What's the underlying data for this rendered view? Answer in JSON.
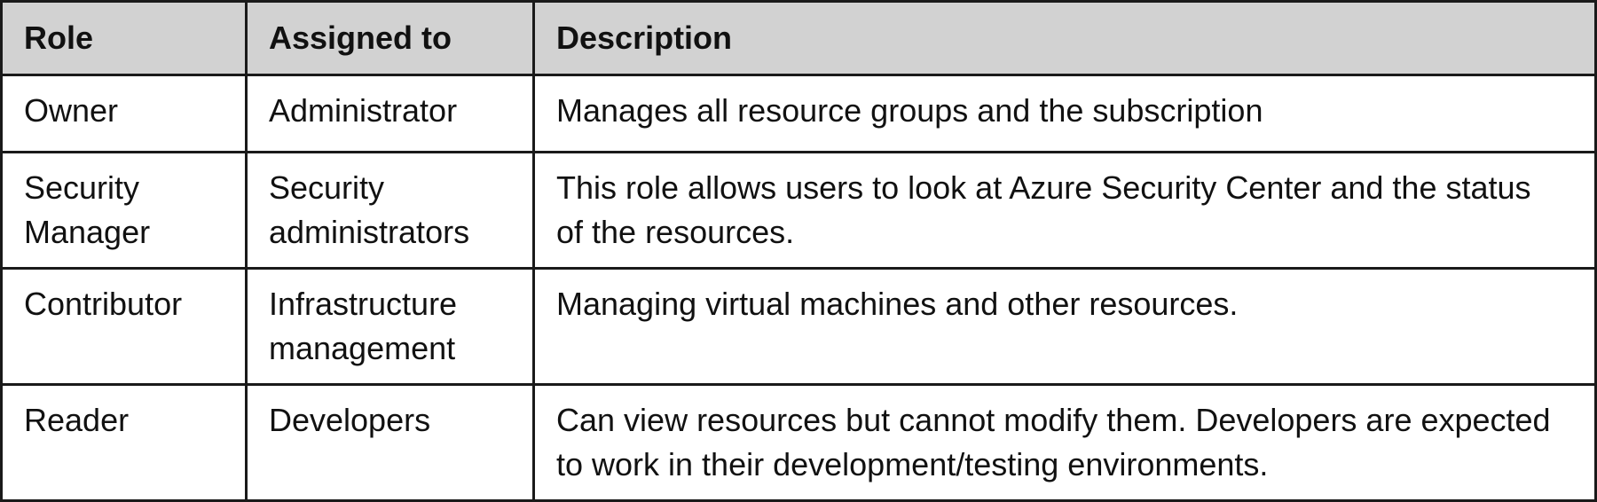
{
  "table": {
    "headers": [
      "Role",
      "Assigned to",
      "Description"
    ],
    "rows": [
      {
        "role": "Owner",
        "assigned_to": "Administrator",
        "description": "Manages all resource groups and the subscription"
      },
      {
        "role": "Security Manager",
        "assigned_to": "Security administrators",
        "description": "This role allows users to look at Azure Security Center and the status of the resources."
      },
      {
        "role": "Contributor",
        "assigned_to": "Infrastructure management",
        "description": "Managing virtual machines and other resources."
      },
      {
        "role": "Reader",
        "assigned_to": "Developers",
        "description": "Can view resources but cannot modify them. Developers are expected to work in their development/testing environments."
      }
    ]
  }
}
